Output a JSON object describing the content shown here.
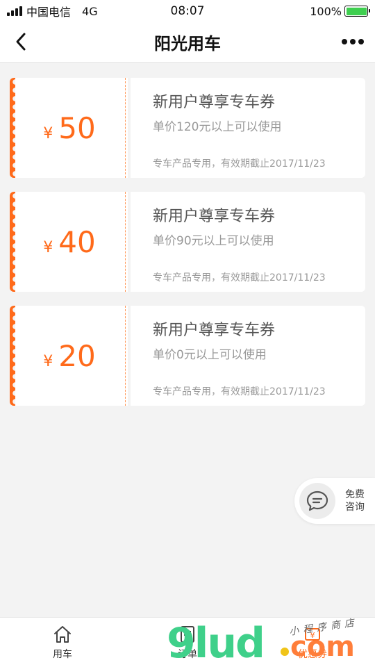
{
  "status_bar": {
    "carrier": "中国电信",
    "network": "4G",
    "time": "08:07",
    "battery": "100%",
    "battery_level": 1.0,
    "battery_color": "#3ecf4f"
  },
  "nav": {
    "title": "阳光用车",
    "back_icon": "chevron-left-icon",
    "more_icon": "more-dots-icon"
  },
  "theme": {
    "accent": "#ff6a1a",
    "background": "#f3f3f3"
  },
  "coupons": [
    {
      "currency": "¥",
      "amount": "50",
      "title": "新用户尊享专车券",
      "condition": "单价120元以上可以使用",
      "note": "专车产品专用，有效期截止2017/11/23"
    },
    {
      "currency": "¥",
      "amount": "40",
      "title": "新用户尊享专车券",
      "condition": "单价90元以上可以使用",
      "note": "专车产品专用，有效期截止2017/11/23"
    },
    {
      "currency": "¥",
      "amount": "20",
      "title": "新用户尊享专车券",
      "condition": "单价0元以上可以使用",
      "note": "专车产品专用，有效期截止2017/11/23"
    }
  ],
  "consult": {
    "line1": "免费",
    "line2": "咨询",
    "icon": "chat-bubble-icon"
  },
  "tabs": [
    {
      "label": "用车",
      "icon": "home-icon"
    },
    {
      "label": "订单",
      "icon": "order-list-icon"
    },
    {
      "label": "优惠券",
      "icon": "coupon-icon",
      "active": true
    }
  ],
  "watermark": {
    "main": "9lud",
    "suffix": "com",
    "sub": "小程序商店"
  }
}
